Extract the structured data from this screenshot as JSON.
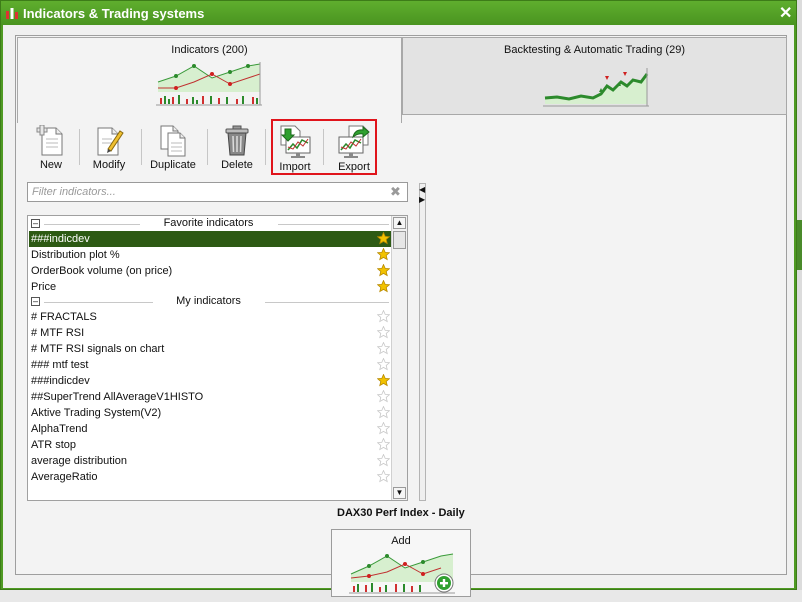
{
  "window": {
    "title": "Indicators & Trading systems"
  },
  "tabs": [
    {
      "label": "Indicators (200)"
    },
    {
      "label": "Backtesting & Automatic Trading (29)"
    }
  ],
  "toolbar": [
    {
      "label": "New",
      "icon": "new-document-icon"
    },
    {
      "label": "Modify",
      "icon": "edit-document-icon"
    },
    {
      "label": "Duplicate",
      "icon": "duplicate-document-icon"
    },
    {
      "label": "Delete",
      "icon": "trash-icon"
    },
    {
      "label": "Import",
      "icon": "import-chart-icon"
    },
    {
      "label": "Export",
      "icon": "export-chart-icon"
    }
  ],
  "filter": {
    "placeholder": "Filter indicators..."
  },
  "groups": [
    {
      "title": "Favorite indicators",
      "items": [
        {
          "name": "###indicdev",
          "favorite": true,
          "selected": true
        },
        {
          "name": "Distribution plot %",
          "favorite": true
        },
        {
          "name": "OrderBook volume (on price)",
          "favorite": true
        },
        {
          "name": "Price",
          "favorite": true
        }
      ]
    },
    {
      "title": "My indicators",
      "items": [
        {
          "name": "# FRACTALS",
          "favorite": false
        },
        {
          "name": "# MTF RSI",
          "favorite": false
        },
        {
          "name": "# MTF RSI signals on chart",
          "favorite": false
        },
        {
          "name": "### mtf test",
          "favorite": false
        },
        {
          "name": "###indicdev",
          "favorite": true
        },
        {
          "name": "##SuperTrend AllAverageV1HISTO",
          "favorite": false
        },
        {
          "name": "Aktive Trading System(V2)",
          "favorite": false
        },
        {
          "name": "AlphaTrend",
          "favorite": false
        },
        {
          "name": "ATR stop",
          "favorite": false
        },
        {
          "name": "average distribution",
          "favorite": false
        },
        {
          "name": "AverageRatio",
          "favorite": false
        }
      ]
    }
  ],
  "instrument": {
    "name": "DAX30 Perf Index - Daily"
  },
  "add_button": {
    "label": "Add"
  },
  "colors": {
    "title_bar": "#4f9a23",
    "selection": "#2d5a14",
    "highlight_border": "#e0141b",
    "favorite_star": "#f2c200"
  }
}
